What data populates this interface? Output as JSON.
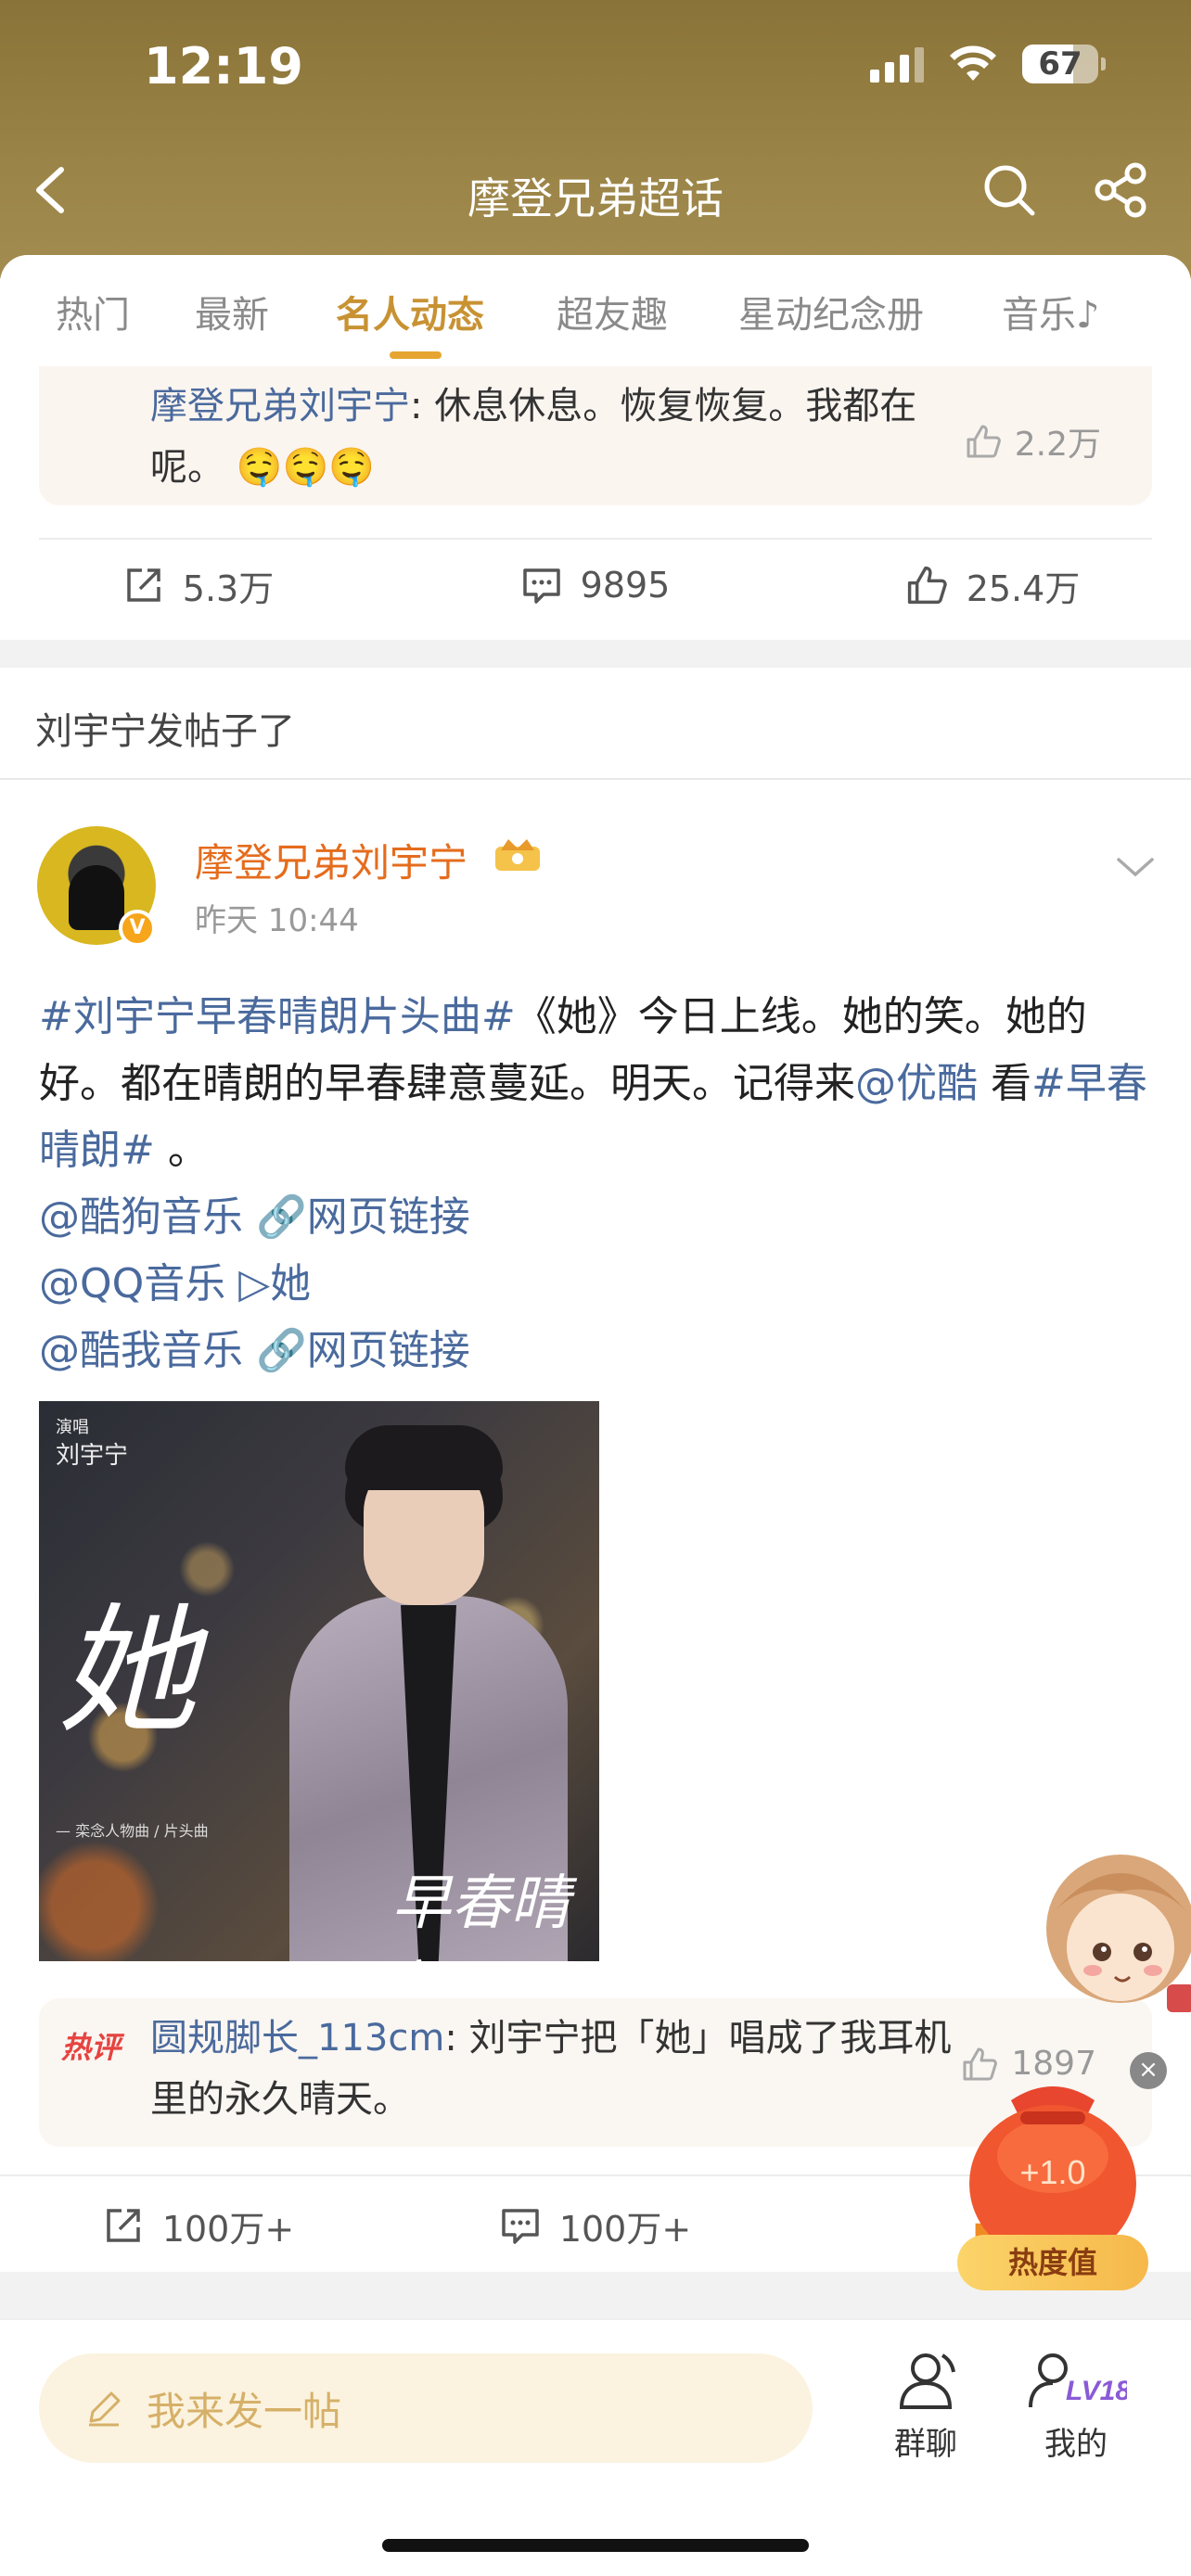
{
  "status_bar": {
    "time": "12:19",
    "battery": "67"
  },
  "nav": {
    "title": "摩登兄弟超话"
  },
  "tabs": [
    "热门",
    "最新",
    "名人动态",
    "超友趣",
    "星动纪念册",
    "音乐♪"
  ],
  "active_tab": "名人动态",
  "prev_post": {
    "hot_comment_author": "摩登兄弟刘宇宁",
    "hot_comment_text": ": 休息休息。恢复恢复。我都在呢。",
    "hot_comment_emoji": "🤤🤤🤤",
    "hot_comment_likes": "2.2万",
    "reposts": "5.3万",
    "comments": "9895",
    "likes": "25.4万"
  },
  "section_title": "刘宇宁发帖子了",
  "post": {
    "author": "摩登兄弟刘宇宁",
    "time": "昨天 10:44",
    "topic1": "#刘宇宁早春晴朗片头曲#",
    "text1": "《她》今日上线。她的笑。她的好。都在晴朗的早春肆意蔓延。明天。记得来",
    "mention_youku": "@优酷",
    "text2": " 看",
    "topic2": "#早春晴朗#",
    "text3": " 。",
    "line_kugou_mention": "@酷狗音乐",
    "line_kugou_link": "🔗网页链接",
    "line_qq_mention": "@QQ音乐",
    "line_qq_link": "▷她",
    "line_kuwo_mention": "@酷我音乐",
    "line_kuwo_link": "🔗网页链接",
    "image": {
      "label_small": "演唱",
      "label_name": "刘宇宁",
      "title": "她",
      "sub": "— 栾念人物曲 / 片头曲",
      "drama": "早春晴朗"
    },
    "hot_comment_tag": "热评",
    "hot_comment_author": "圆规脚长_113cm",
    "hot_comment_text": ": 刘宇宁把「她」唱成了我耳机里的永久晴天。",
    "hot_comment_likes": "1897",
    "reposts": "100万+",
    "comments": "100万+"
  },
  "heat": {
    "plus": "+1.0",
    "label": "热度值"
  },
  "bottom": {
    "compose_placeholder": "我来发一帖",
    "group_chat": "群聊",
    "mine": "我的",
    "level": "LV18"
  },
  "colors": {
    "header_gold": "#9b8447",
    "accent": "#c89233",
    "link": "#4a6a9d",
    "author": "#e56c1d"
  }
}
